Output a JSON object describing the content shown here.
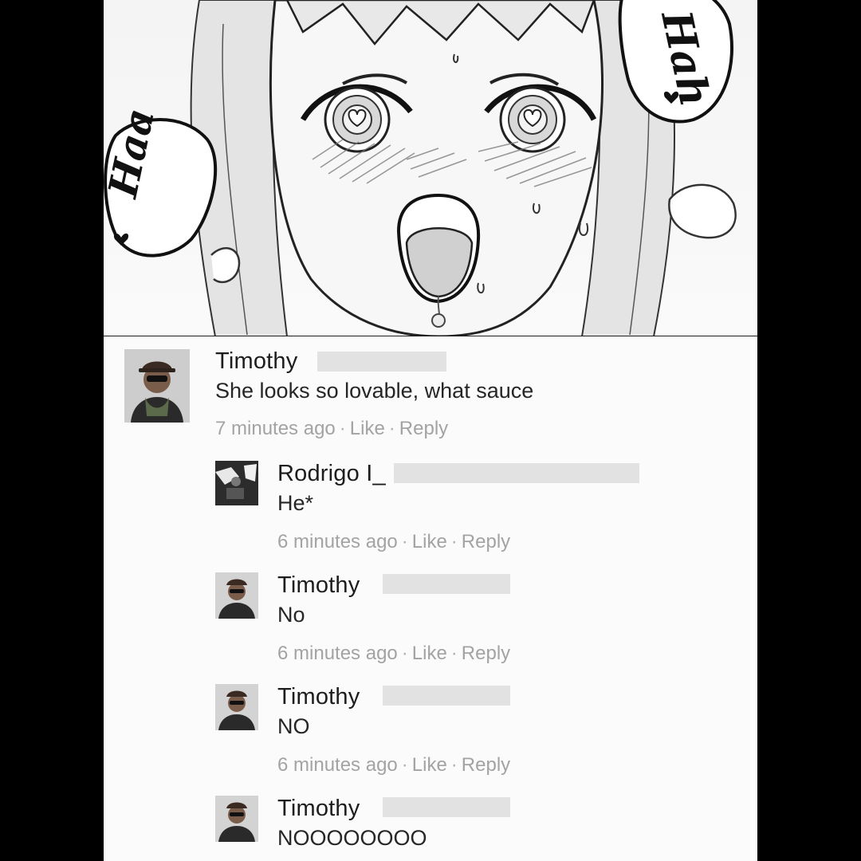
{
  "panel": {
    "sfx_left": "Haa",
    "sfx_right": "Hah"
  },
  "comments": [
    {
      "author": "Timothy",
      "body": "She looks so lovable, what sauce",
      "time": "7 minutes ago",
      "like": "Like",
      "reply": "Reply",
      "avatar": "person-sunglasses-scarf"
    },
    {
      "author": "Rodrigo I_",
      "body": "He*",
      "time": "6 minutes ago",
      "like": "Like",
      "reply": "Reply",
      "avatar": "dark-photo"
    },
    {
      "author": "Timothy",
      "body": "No",
      "time": "6 minutes ago",
      "like": "Like",
      "reply": "Reply",
      "avatar": "person-sunglasses-scarf"
    },
    {
      "author": "Timothy",
      "body": "NO",
      "time": "6 minutes ago",
      "like": "Like",
      "reply": "Reply",
      "avatar": "person-sunglasses-scarf"
    },
    {
      "author": "Timothy",
      "body": "NOOOOOOOO",
      "avatar": "person-sunglasses-scarf"
    }
  ],
  "colors": {
    "background": "#000000",
    "panel_bg": "#fbfbfb",
    "meta_text": "#a6a6a6",
    "redaction": "#e2e2e2"
  }
}
